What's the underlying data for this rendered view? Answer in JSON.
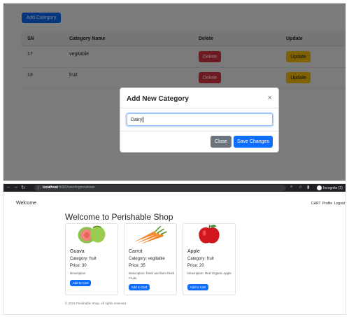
{
  "admin": {
    "add_category_label": "Add Category",
    "table": {
      "headers": {
        "sn": "SN",
        "name": "Category Name",
        "delete": "Delete",
        "update": "Update"
      },
      "rows": [
        {
          "sn": "17",
          "name": "vegitable",
          "delete": "Delete",
          "update": "Update"
        },
        {
          "sn": "13",
          "name": "fruit",
          "delete": "Delete",
          "update": "Update"
        }
      ]
    },
    "modal": {
      "title": "Add New Category",
      "close_icon": "×",
      "input_value": "Dairy",
      "close_label": "Close",
      "save_label": "Save Changes"
    }
  },
  "browser": {
    "url_host": "localhost",
    "url_path": ":8080/user/loginvalidate",
    "incognito_label": "Incognito (2)",
    "icons": {
      "back": "back-arrow-icon",
      "forward": "forward-arrow-icon",
      "reload": "reload-icon",
      "info": "info-icon"
    }
  },
  "shop": {
    "brand": "Welcome",
    "nav": [
      "CART",
      "Profile",
      "Logout"
    ],
    "heading": "Welcome to Perishable Shop",
    "products": [
      {
        "name": "Guava",
        "category": "Category: fruit",
        "price": "Price: 30",
        "description": "Description",
        "button": "Add to Cart"
      },
      {
        "name": "Carrot",
        "category": "Category: vegitable",
        "price": "Price: 35",
        "description": "Description: fresh and farm fresh Fruits",
        "button": "Add to Cart"
      },
      {
        "name": "Apple",
        "category": "Category: fruit",
        "price": "Price: 20",
        "description": "Description: Red Organic Apple",
        "button": "Add to Cart"
      }
    ],
    "footer": "© 2023 Perishable Shop. All rights reserved."
  },
  "colors": {
    "primary": "#0d6efd",
    "danger": "#dc3545",
    "warning": "#ffc107",
    "secondary": "#6c757d"
  }
}
